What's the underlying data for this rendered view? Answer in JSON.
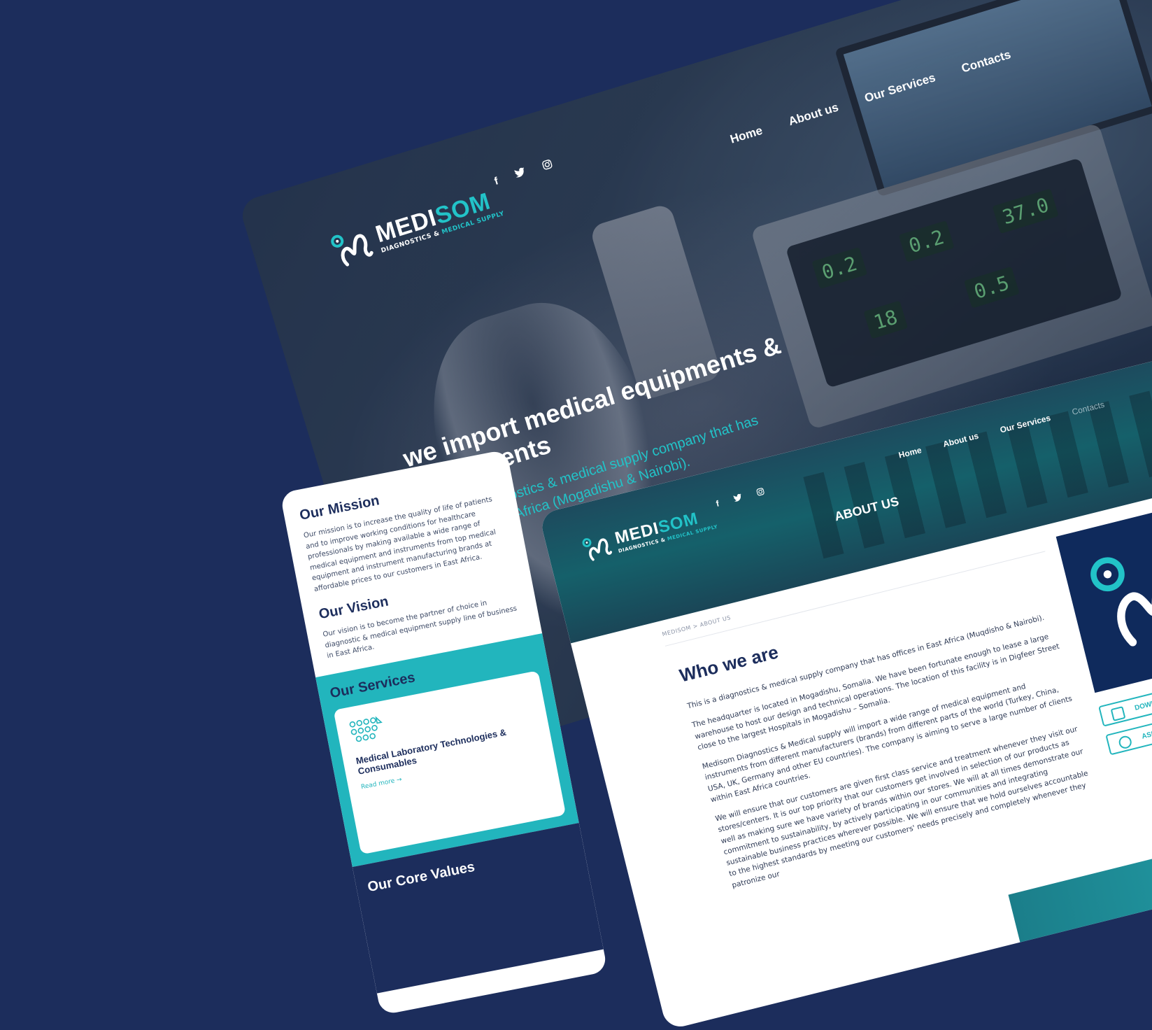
{
  "brand": {
    "name_part1": "MEDI",
    "name_part2": "SOM",
    "tagline_part1": "DIAGNOSTICS & ",
    "tagline_part2": "MEDICAL SUPPLY",
    "color_navy": "#1c2d5c",
    "color_teal": "#22c3c8"
  },
  "socials": [
    "f",
    "t",
    "ig"
  ],
  "hero": {
    "nav": [
      "Home",
      "About us",
      "Our Services",
      "Contacts"
    ],
    "headline": "we import medical equipments & instruments",
    "subtext": "This is a diagnostics & medical supply company that has offices in East Africa (Mogadishu & Nairobi).",
    "readouts": [
      "0.2",
      "0.2",
      "37.0",
      "18",
      "0.5"
    ]
  },
  "mobile": {
    "mission_title": "Our Mission",
    "mission_text": "Our mission is to increase the quality of life of patients and to improve working conditions for healthcare professionals by making available a wide range of medical equipment and instruments from top medical equipment and instrument manufacturing brands at affordable prices to our customers in East Africa.",
    "vision_title": "Our Vision",
    "vision_text": "Our vision is to become the partner of choice in diagnostic & medical equipment supply line of business in East Africa.",
    "services_title": "Our Services",
    "service_card_title": "Medical Laboratory Technologies & Consumables",
    "read_more": "Read more →",
    "core_values_title": "Our Core Values"
  },
  "about": {
    "nav": [
      "Home",
      "About us",
      "Our Services",
      "Contacts"
    ],
    "page_title": "ABOUT US",
    "breadcrumb": "MEDISOM > ABOUT US",
    "heading": "Who we are",
    "paragraphs": [
      "This is a diagnostics & medical supply company that has offices in East Africa (Muqdisho & Nairobi).",
      "The headquarter is located in Mogadishu, Somalia. We have been fortunate enough to lease a large warehouse to host our design and technical operations. The location of this facility is in Digfeer Street close to the largest Hospitals in Mogadishu – Somalia.",
      "Medisom Diagnostics & Medical supply will import a wide range of medical equipment and instruments from different manufacturers (brands) from different parts of the world (Turkey, China, USA, UK, Germany and other EU countries). The company is aiming to serve a large number of clients within East Africa countries.",
      "We will ensure that our customers are given first class service and treatment whenever they visit our stores/centers. It is our top priority that our customers get involved in selection of our products as well as making sure we have variety of brands within our stores. We will at all times demonstrate our commitment to sustainability, by actively participating in our communities and integrating sustainable business practices wherever possible. We will ensure that we hold ourselves accountable to the highest standards by meeting our customers' needs precisely and completely whenever they patronize our"
    ],
    "download_label": "DOWNLO",
    "ask_label": "ASK"
  }
}
